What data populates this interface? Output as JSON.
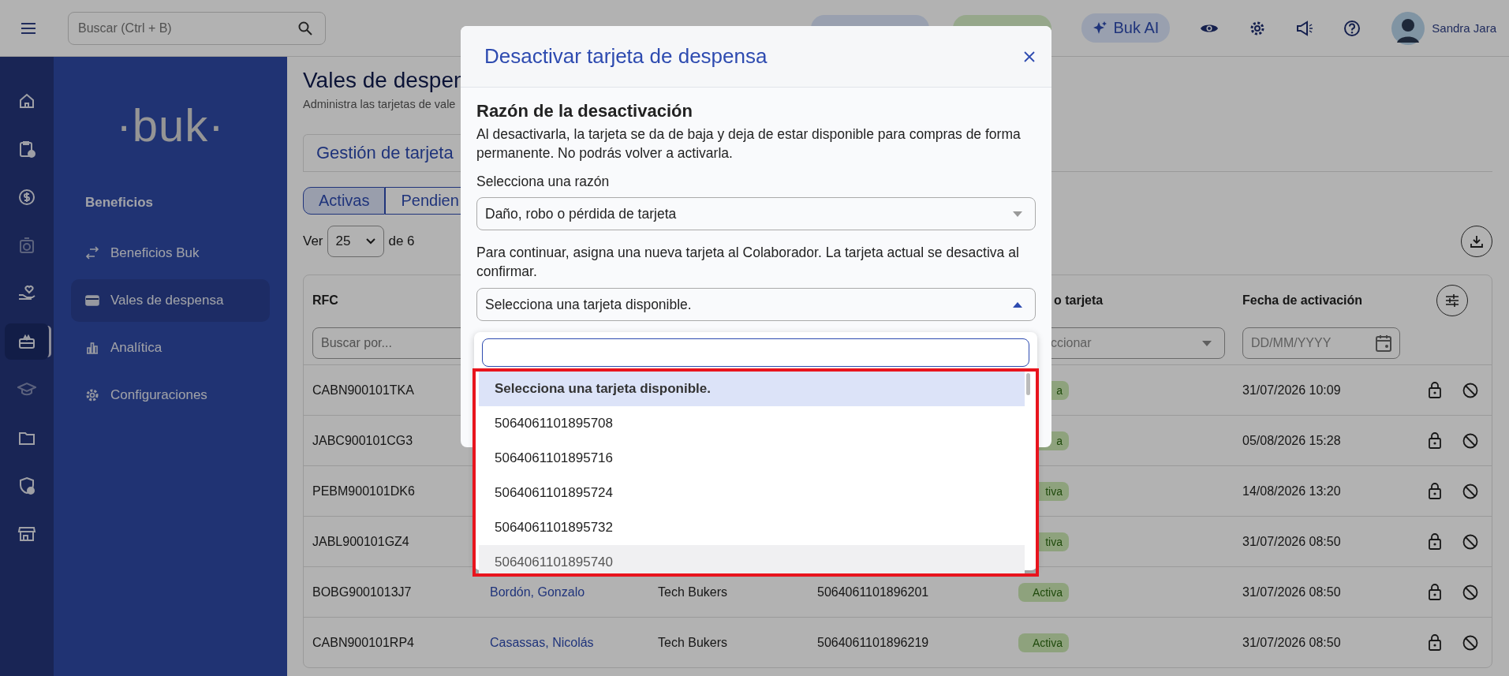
{
  "topbar": {
    "search": {
      "placeholder": "Buscar (Ctrl + B)"
    },
    "ai_button": "Buk AI",
    "user_name": "Sandra Jara"
  },
  "rail": [
    {
      "selected": false
    },
    {
      "selected": false
    },
    {
      "selected": false
    },
    {
      "selected": false
    },
    {
      "selected": false
    },
    {
      "selected": true
    },
    {
      "selected": false
    },
    {
      "selected": false
    },
    {
      "selected": false
    },
    {
      "selected": false
    }
  ],
  "sidebar": {
    "logo": "·buk·",
    "section": "Beneficios",
    "items": [
      {
        "label": "Beneficios Buk",
        "selected": false
      },
      {
        "label": "Vales de despensa",
        "selected": true
      },
      {
        "label": "Analítica",
        "selected": false
      },
      {
        "label": "Configuraciones",
        "selected": false
      }
    ]
  },
  "page": {
    "title": "Vales de despen",
    "subtitle": "Administra las tarjetas de vale",
    "tab": "Gestión de tarjeta",
    "segments": [
      {
        "label": "Activas",
        "selected": true
      },
      {
        "label": "Pendien",
        "selected": false
      }
    ],
    "per_page_label": "Ver",
    "per_page": "25",
    "of_label": "de 6"
  },
  "table": {
    "header": {
      "rfc": "RFC",
      "status": "o tarjeta",
      "date": "Fecha de activación"
    },
    "filters": {
      "rfc": {
        "placeholder": "Buscar por..."
      },
      "status": {
        "placeholder": "ccionar"
      },
      "date": {
        "placeholder": "DD/MM/YYYY"
      }
    },
    "rows": [
      {
        "rfc": "CABN900101TKA",
        "status": "a",
        "date": "31/07/2026 10:09"
      },
      {
        "rfc": "JABC900101CG3",
        "status": "a",
        "date": "05/08/2026 15:28"
      },
      {
        "rfc": "PEBM900101DK6",
        "status": "tiva",
        "date": "14/08/2026 13:20"
      },
      {
        "rfc": "JABL900101GZ4",
        "status": "tiva",
        "date": "31/07/2026 08:50"
      },
      {
        "rfc": "BOBG9001013J7",
        "name": "Bordón, Gonzalo",
        "company": "Tech Bukers",
        "card": "5064061101896201",
        "status": "Activa",
        "date": "31/07/2026 08:50"
      },
      {
        "rfc": "CABN900101RP4",
        "name": "Casassas, Nicolás",
        "company": "Tech Bukers",
        "card": "5064061101896219",
        "status": "Activa",
        "date": "31/07/2026 08:50"
      }
    ]
  },
  "modal": {
    "title": "Desactivar tarjeta de despensa",
    "section_title": "Razón de la desactivación",
    "description": "Al desactivarla, la tarjeta se da de baja y deja de estar disponible para compras de forma permanente. No podrás volver a activarla.",
    "reason_label": "Selecciona una razón",
    "reason_value": "Daño, robo o pérdida de tarjeta",
    "instruction": "Para continuar, asigna una nueva tarjeta al Colaborador. La tarjeta actual se desactiva al confirmar.",
    "card_select": {
      "placeholder": "Selecciona una tarjeta disponible.",
      "expanded": true
    },
    "options": [
      {
        "label": "Selecciona una tarjeta disponible.",
        "selected": true
      },
      {
        "label": "5064061101895708",
        "selected": false
      },
      {
        "label": "5064061101895716",
        "selected": false
      },
      {
        "label": "5064061101895724",
        "selected": false
      },
      {
        "label": "5064061101895732",
        "selected": false
      },
      {
        "label": "5064061101895740",
        "selected": false
      }
    ]
  }
}
